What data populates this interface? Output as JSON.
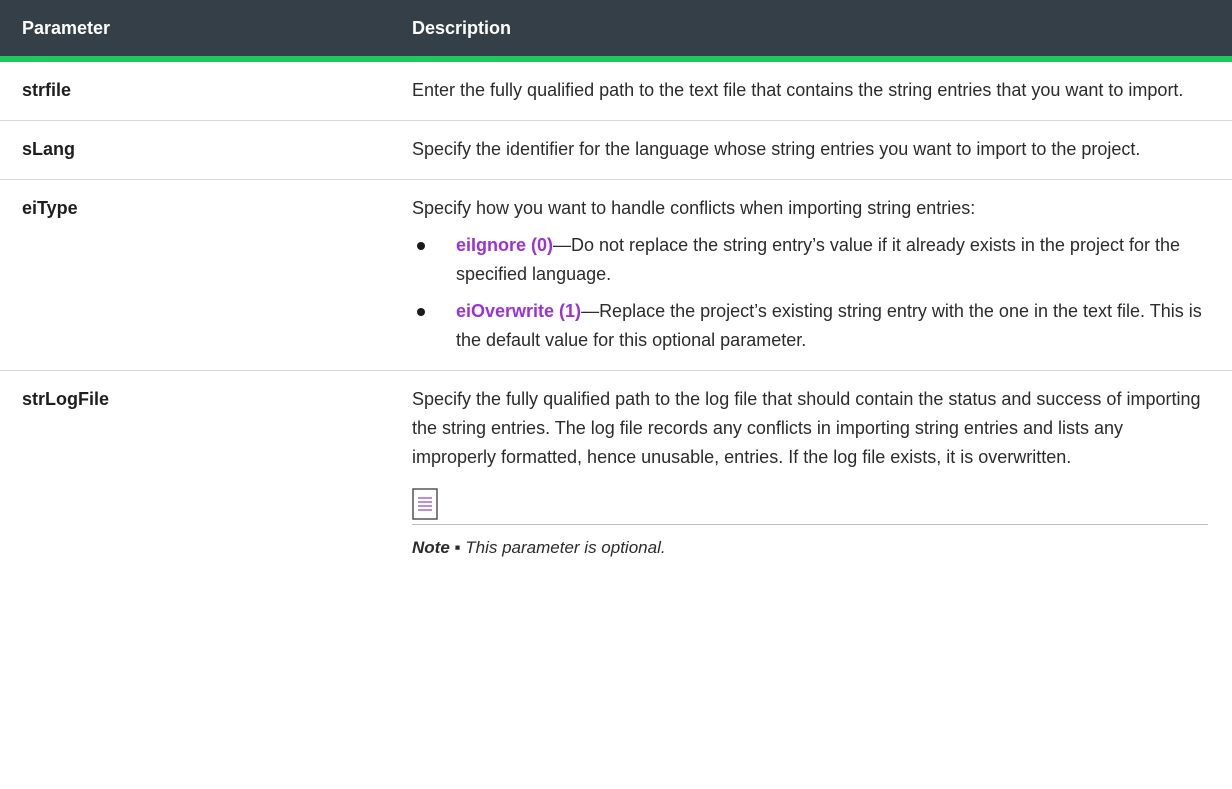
{
  "table": {
    "headers": {
      "parameter": "Parameter",
      "description": "Description"
    },
    "rows": [
      {
        "name": "strfile",
        "description": "Enter the fully qualified path to the text file that contains the string entries that you want to import."
      },
      {
        "name": "sLang",
        "description": "Specify the identifier for the language whose string entries you want to import to the project."
      },
      {
        "name": "eiType",
        "description": "Specify how you want to handle conflicts when importing string entries:",
        "options": [
          {
            "term": "eiIgnore (0)",
            "text": "—Do not replace the string entry’s value if it already exists in the project for the specified language."
          },
          {
            "term": "eiOverwrite (1)",
            "text": "—Replace the project’s existing string entry with the one in the text file. This is the default value for this optional parameter."
          }
        ]
      },
      {
        "name": "strLogFile",
        "description": "Specify the fully qualified path to the log file that should contain the status and success of importing the string entries. The log file records any conflicts in importing string entries and lists any improperly formatted, hence unusable, entries. If the log file exists, it is overwritten.",
        "note": {
          "icon": "note-icon",
          "label": "Note ▪ ",
          "text": "This parameter is optional."
        }
      }
    ]
  },
  "colors": {
    "header_bg": "#343f48",
    "header_accent": "#22c55e",
    "option_term": "#9a33d6"
  }
}
